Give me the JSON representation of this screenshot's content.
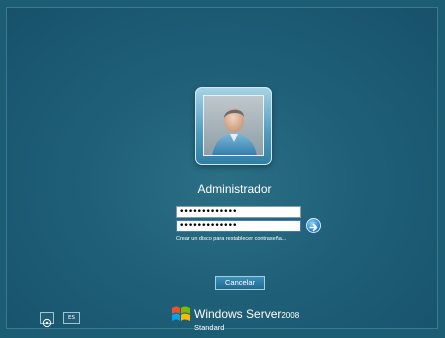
{
  "login": {
    "username": "Administrador",
    "password_mask_1": "•••••••••••••",
    "password_mask_2": "•••••••••••••",
    "reset_link": "Crear un disco para restablecer contraseña...",
    "cancel_label": "Cancelar"
  },
  "footer": {
    "language": "ES",
    "ease_of_access_icon": "ease-of-access-icon"
  },
  "branding": {
    "product_name": "Windows Server",
    "version": "2008",
    "edition": "Standard"
  },
  "colors": {
    "background": "#1d5d74",
    "accent": "#1d79c8",
    "text": "#ffffff"
  }
}
